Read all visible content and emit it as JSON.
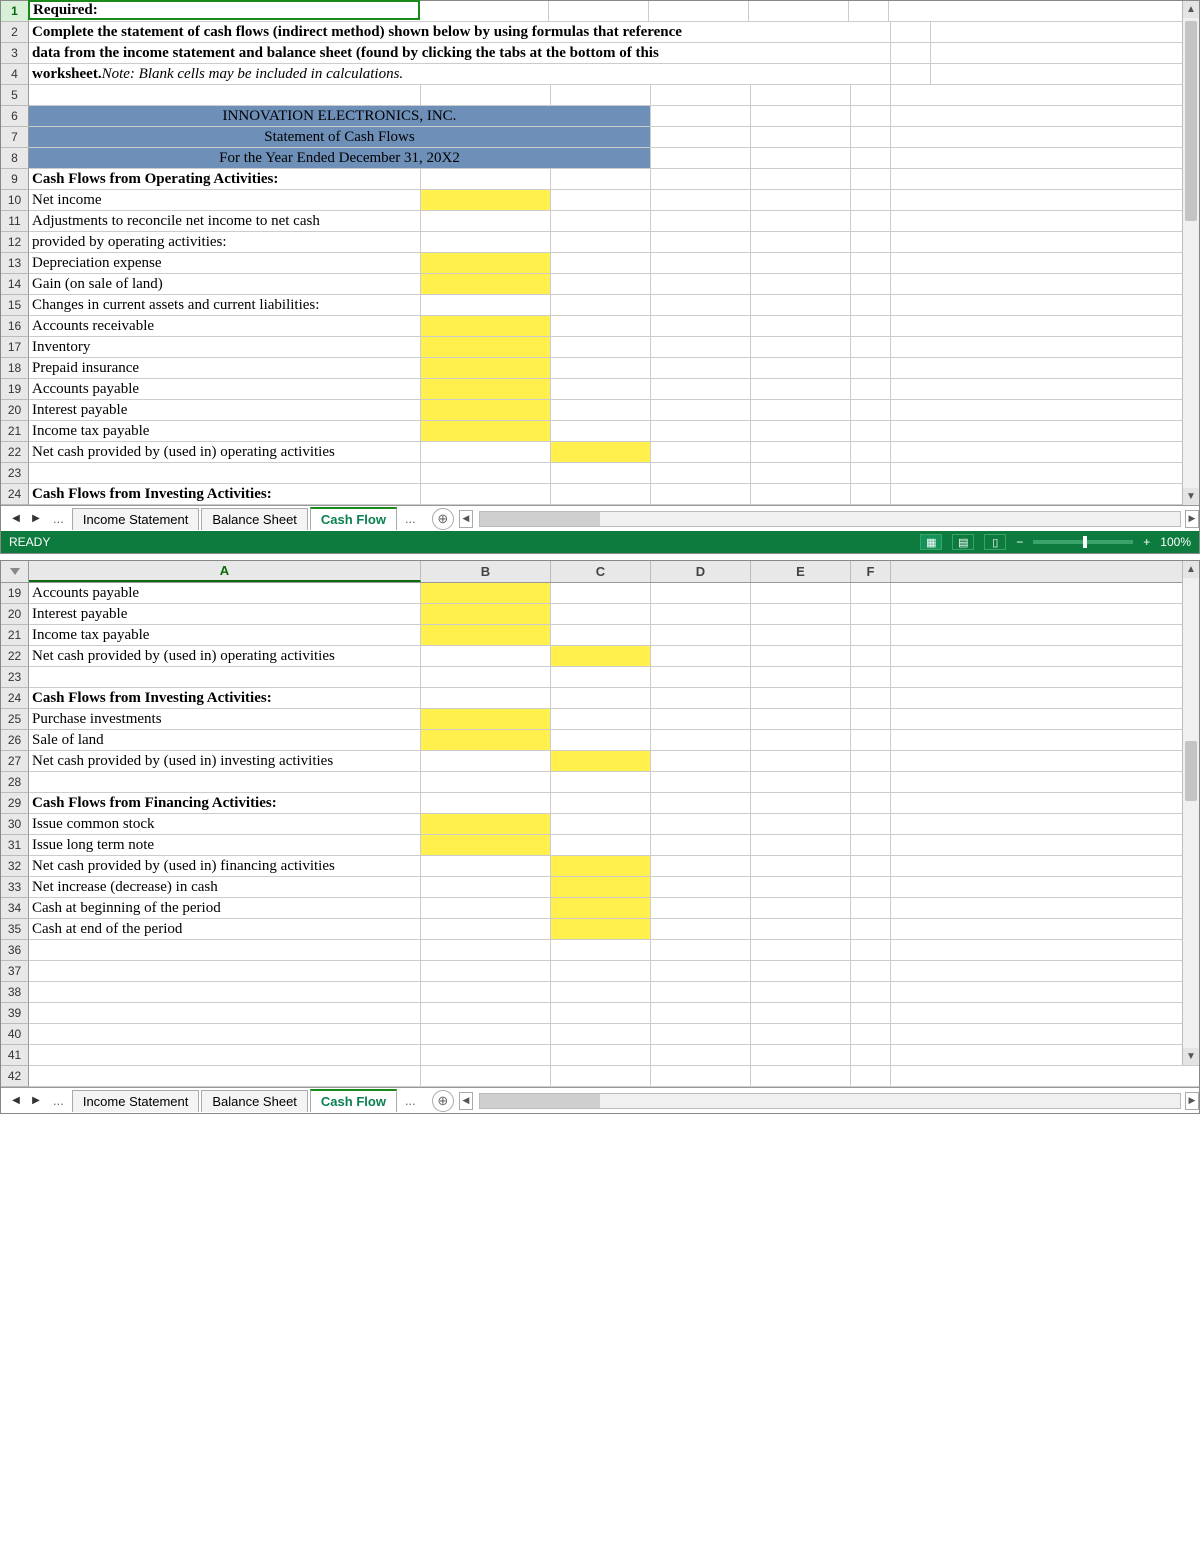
{
  "pane1": {
    "rows": [
      {
        "n": 1,
        "a": "Required:",
        "bold": true,
        "selected": true
      },
      {
        "n": 2,
        "a": "Complete the statement of cash flows (indirect method) shown below by using formulas that reference",
        "bold": true,
        "wide": true
      },
      {
        "n": 3,
        "a": "data from the income statement and balance sheet (found by clicking the tabs at the bottom of this",
        "bold": true,
        "wide": true
      },
      {
        "n": 4,
        "a": "worksheet.",
        "bold": true,
        "a2": "Note: Blank cells may be included in calculations.",
        "a2italic": true,
        "wide": true
      },
      {
        "n": 5,
        "a": ""
      },
      {
        "n": 6,
        "a": "INNOVATION ELECTRONICS, INC.",
        "header": true
      },
      {
        "n": 7,
        "a": "Statement of Cash Flows",
        "header": true
      },
      {
        "n": 8,
        "a": "For the Year Ended December 31, 20X2",
        "header": true
      },
      {
        "n": 9,
        "a": "Cash Flows from Operating Activities:",
        "bold": true
      },
      {
        "n": 10,
        "a": "Net income",
        "yellowB": true
      },
      {
        "n": 11,
        "a": "Adjustments to reconcile net income to net cash"
      },
      {
        "n": 12,
        "a": "provided by operating activities:"
      },
      {
        "n": 13,
        "a": "Depreciation expense",
        "yellowB": true
      },
      {
        "n": 14,
        "a": "Gain (on sale of land)",
        "yellowB": true
      },
      {
        "n": 15,
        "a": "Changes in current assets and current liabilities:"
      },
      {
        "n": 16,
        "a": "Accounts receivable",
        "yellowB": true
      },
      {
        "n": 17,
        "a": "Inventory",
        "yellowB": true
      },
      {
        "n": 18,
        "a": "Prepaid insurance",
        "yellowB": true
      },
      {
        "n": 19,
        "a": "Accounts payable",
        "yellowB": true
      },
      {
        "n": 20,
        "a": "Interest payable",
        "yellowB": true
      },
      {
        "n": 21,
        "a": "Income tax payable",
        "yellowB": true
      },
      {
        "n": 22,
        "a": "Net cash provided by (used in) operating activities",
        "yellowC": true
      },
      {
        "n": 23,
        "a": ""
      },
      {
        "n": 24,
        "a": "Cash Flows from Investing Activities:",
        "bold": true
      }
    ]
  },
  "pane2": {
    "colHeaders": [
      "A",
      "B",
      "C",
      "D",
      "E",
      "F"
    ],
    "rows": [
      {
        "n": 19,
        "a": "Accounts payable",
        "yellowB": true
      },
      {
        "n": 20,
        "a": "Interest payable",
        "yellowB": true
      },
      {
        "n": 21,
        "a": "Income tax payable",
        "yellowB": true
      },
      {
        "n": 22,
        "a": "Net cash provided by (used in) operating activities",
        "yellowC": true
      },
      {
        "n": 23,
        "a": ""
      },
      {
        "n": 24,
        "a": "Cash Flows from Investing Activities:",
        "bold": true
      },
      {
        "n": 25,
        "a": "Purchase investments",
        "yellowB": true
      },
      {
        "n": 26,
        "a": "Sale of land",
        "yellowB": true
      },
      {
        "n": 27,
        "a": "Net cash provided by (used in) investing activities",
        "yellowC": true
      },
      {
        "n": 28,
        "a": ""
      },
      {
        "n": 29,
        "a": "Cash Flows from Financing Activities:",
        "bold": true
      },
      {
        "n": 30,
        "a": "Issue common stock",
        "yellowB": true
      },
      {
        "n": 31,
        "a": "Issue long term note",
        "yellowB": true
      },
      {
        "n": 32,
        "a": "Net cash provided by (used in) financing activities",
        "yellowC": true
      },
      {
        "n": 33,
        "a": "Net increase (decrease) in cash",
        "yellowC": true
      },
      {
        "n": 34,
        "a": "Cash at beginning of the period",
        "yellowC": true
      },
      {
        "n": 35,
        "a": "Cash at end of the period",
        "yellowC": true
      },
      {
        "n": 36,
        "a": ""
      },
      {
        "n": 37,
        "a": ""
      },
      {
        "n": 38,
        "a": ""
      },
      {
        "n": 39,
        "a": ""
      },
      {
        "n": 40,
        "a": ""
      },
      {
        "n": 41,
        "a": ""
      },
      {
        "n": 42,
        "a": ""
      }
    ]
  },
  "tabs": {
    "items": [
      "Income Statement",
      "Balance Sheet",
      "Cash Flow"
    ],
    "activeIndex": 2,
    "ellipsis": "..."
  },
  "status": {
    "ready": "READY",
    "zoom": "100%"
  }
}
